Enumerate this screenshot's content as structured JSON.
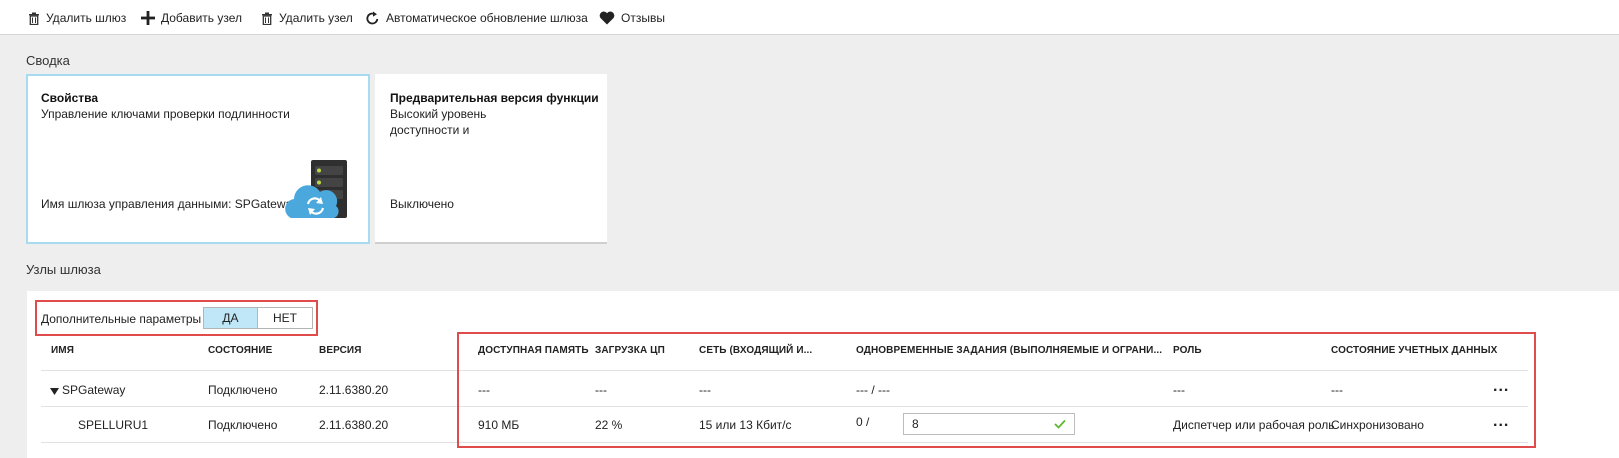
{
  "toolbar": {
    "delete_gateway": "Удалить шлюз",
    "add_node": "Добавить узел",
    "delete_node": "Удалить узел",
    "auto_update": "Автоматическое обновление шлюза",
    "feedback": "Отзывы"
  },
  "summary": {
    "title": "Сводка",
    "properties": {
      "title": "Свойства",
      "subtitle": "Управление ключами проверки подлинности",
      "gateway_label": "Имя шлюза управления данными: SPGateway"
    },
    "preview": {
      "title": "Предварительная версия функции",
      "line1": "Высокий уровень",
      "line2": "доступности и",
      "status": "Выключено"
    }
  },
  "nodes": {
    "title": "Узлы шлюза",
    "advanced_label": "Дополнительные параметры",
    "toggle_yes": "ДА",
    "toggle_no": "НЕТ",
    "columns": {
      "name": "ИМЯ",
      "status": "СОСТОЯНИЕ",
      "version": "ВЕРСИЯ",
      "memory": "ДОСТУПНАЯ ПАМЯТЬ",
      "cpu": "ЗАГРУЗКА ЦП",
      "network": "СЕТЬ (ВХОДЯЩИЙ И...",
      "jobs": "ОДНОВРЕМЕННЫЕ ЗАДАНИЯ (ВЫПОЛНЯЕМЫЕ И ОГРАНИ...",
      "role": "РОЛЬ",
      "credentials": "СОСТОЯНИЕ УЧЕТНЫХ ДАННЫХ"
    },
    "rows": [
      {
        "name": "SPGateway",
        "status": "Подключено",
        "version": "2.11.6380.20",
        "memory": "---",
        "cpu": "---",
        "network": "---",
        "jobs": "--- / ---",
        "role": "---",
        "credentials": "---"
      },
      {
        "name": "SPELLURU1",
        "status": "Подключено",
        "version": "2.11.6380.20",
        "memory": "910 МБ",
        "cpu": "22 %",
        "network": "15 или 13 Кбит/с",
        "jobs_prefix": "0 /",
        "jobs_limit": "8",
        "role": "Диспетчер или рабочая роль",
        "credentials": "Синхронизовано"
      }
    ],
    "more": "..."
  },
  "colors": {
    "highlight_box": "#e04b4b",
    "toggle_active": "#bfe7f7",
    "cloud": "#4aa8dc",
    "check": "#5cb82f"
  }
}
